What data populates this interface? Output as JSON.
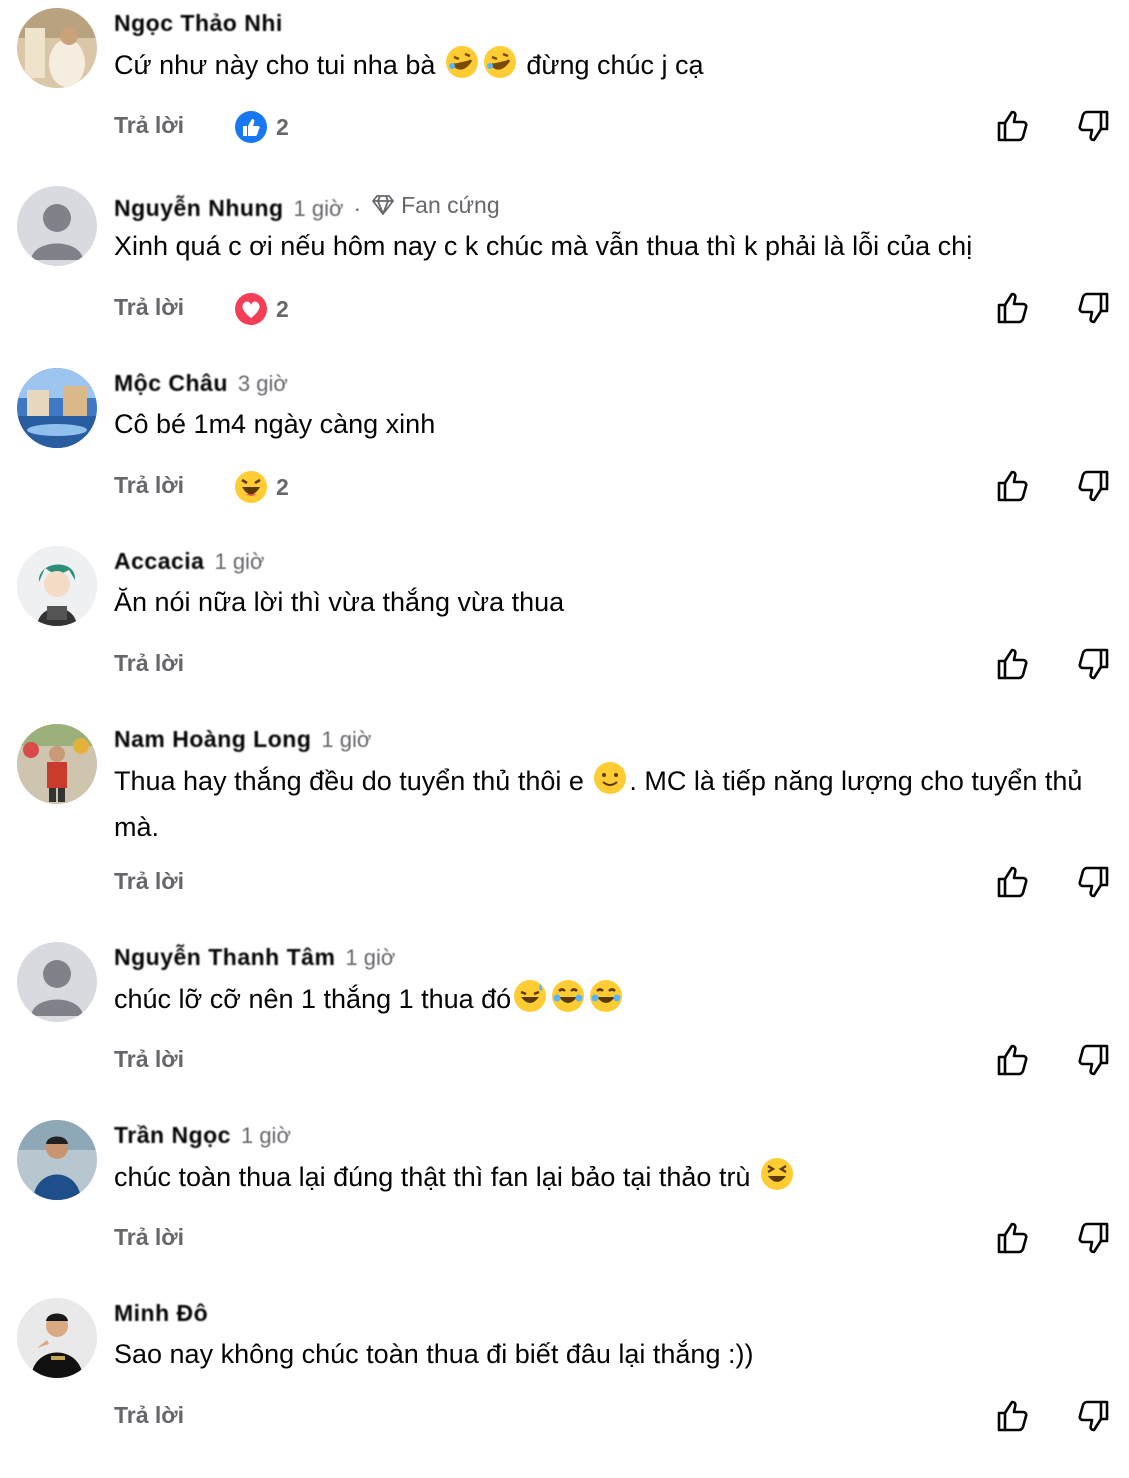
{
  "reply_label": "Trả lời",
  "fan_badge": "Fan cứng",
  "colors": {
    "like_blue": "#1877f2",
    "heart_red": "#f33e58",
    "muted": "#65676b"
  },
  "comments": [
    {
      "author": "Ngọc Thảo Nhi",
      "time": "",
      "text": "Cứ như này cho tui nha bà",
      "text_after": "đừng chúc j cạ",
      "reaction": {
        "type": "like",
        "count": "2"
      }
    },
    {
      "author": "Nguyễn Nhung",
      "time": "1 giờ",
      "text": "Xinh quá c ơi nếu hôm nay c k chúc mà vẫn thua thì k phải là lỗi của chị",
      "reaction": {
        "type": "love",
        "count": "2"
      }
    },
    {
      "author": "Mộc Châu",
      "time": "3 giờ",
      "text": "Cô bé 1m4 ngày càng xinh",
      "reaction": {
        "type": "haha",
        "count": "2"
      }
    },
    {
      "author": "Accacia",
      "time": "1 giờ",
      "text": "Ăn nói nữa lời thì vừa thắng vừa thua",
      "reaction": null
    },
    {
      "author": "Nam Hoàng Long",
      "time": "1 giờ",
      "text": "Thua hay thắng đều do tuyển thủ thôi e",
      "text_after": ". MC là tiếp năng lượng cho tuyển thủ mà.",
      "reaction": null
    },
    {
      "author": "Nguyễn Thanh Tâm",
      "time": "1 giờ",
      "text": "chúc lỡ cỡ nên 1 thắng 1 thua đó",
      "reaction": null
    },
    {
      "author": "Trần Ngọc",
      "time": "1 giờ",
      "text": "chúc toàn thua lại đúng thật thì fan lại bảo tại thảo trù",
      "reaction": null
    },
    {
      "author": "Minh Đô",
      "time": "",
      "text": "Sao nay không chúc toàn thua đi biết đâu lại thắng :))",
      "reaction": null
    }
  ]
}
